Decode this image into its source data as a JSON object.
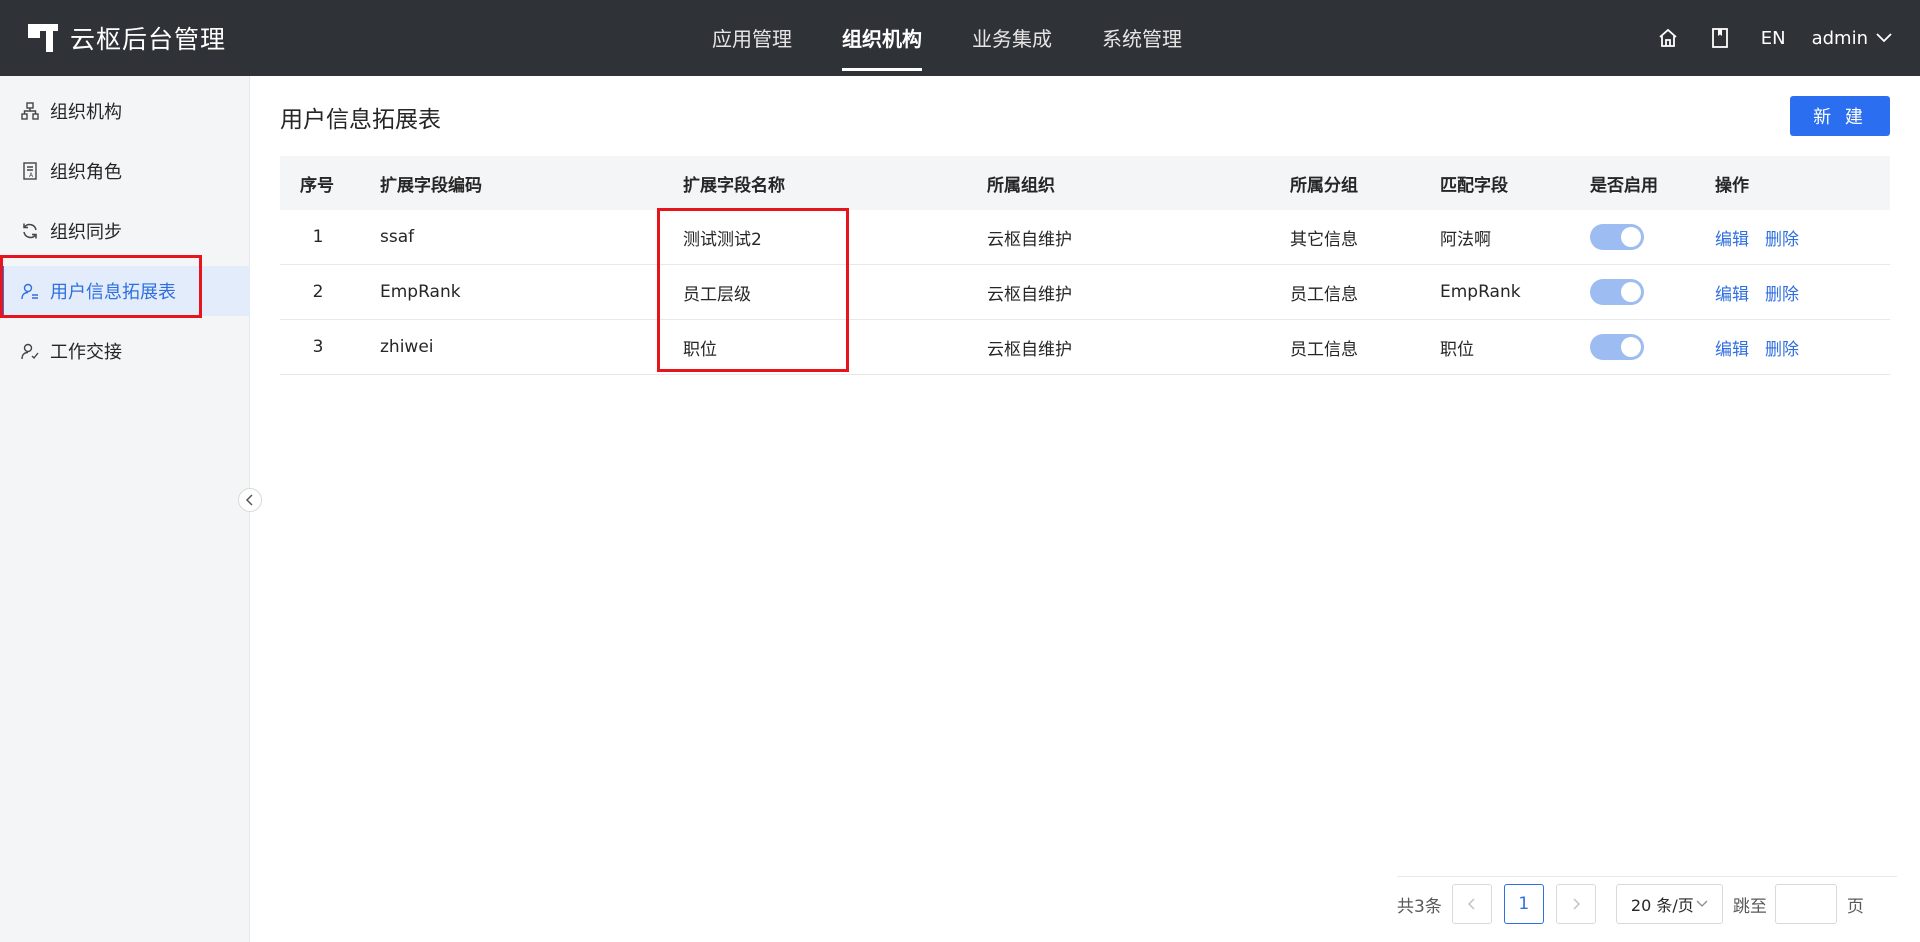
{
  "header": {
    "app_name": "云枢后台管理",
    "nav": [
      {
        "label": "应用管理",
        "active": false
      },
      {
        "label": "组织机构",
        "active": true
      },
      {
        "label": "业务集成",
        "active": false
      },
      {
        "label": "系统管理",
        "active": false
      }
    ],
    "icons": [
      "home-icon",
      "book-icon"
    ],
    "lang": "EN",
    "user": "admin"
  },
  "sidebar": {
    "items": [
      {
        "label": "组织机构",
        "icon": "org-tree-icon",
        "active": false
      },
      {
        "label": "组织角色",
        "icon": "role-card-icon",
        "active": false
      },
      {
        "label": "组织同步",
        "icon": "sync-icon",
        "active": false
      },
      {
        "label": "用户信息拓展表",
        "icon": "user-ext-icon",
        "active": true
      },
      {
        "label": "工作交接",
        "icon": "user-handover-icon",
        "active": false
      }
    ]
  },
  "main": {
    "title": "用户信息拓展表",
    "new_button": "新 建",
    "columns": [
      "序号",
      "扩展字段编码",
      "扩展字段名称",
      "所属组织",
      "所属分组",
      "匹配字段",
      "是否启用",
      "操作"
    ],
    "rows": [
      {
        "index": "1",
        "code": "ssaf",
        "name": "测试测试2",
        "org": "云枢自维护",
        "group": "其它信息",
        "match": "阿法啊",
        "enabled": true,
        "edit": "编辑",
        "delete": "删除"
      },
      {
        "index": "2",
        "code": "EmpRank",
        "name": "员工层级",
        "org": "云枢自维护",
        "group": "员工信息",
        "match": "EmpRank",
        "enabled": true,
        "edit": "编辑",
        "delete": "删除"
      },
      {
        "index": "3",
        "code": "zhiwei",
        "name": "职位",
        "org": "云枢自维护",
        "group": "员工信息",
        "match": "职位",
        "enabled": true,
        "edit": "编辑",
        "delete": "删除"
      }
    ]
  },
  "pagination": {
    "total": "共3条",
    "current_page": "1",
    "page_size": "20 条/页",
    "jump_label": "跳至",
    "page_suffix": "页",
    "jump_value": ""
  },
  "colors": {
    "header_bg": "#2f3236",
    "accent": "#2b6ff0",
    "highlight": "#e8141b"
  }
}
